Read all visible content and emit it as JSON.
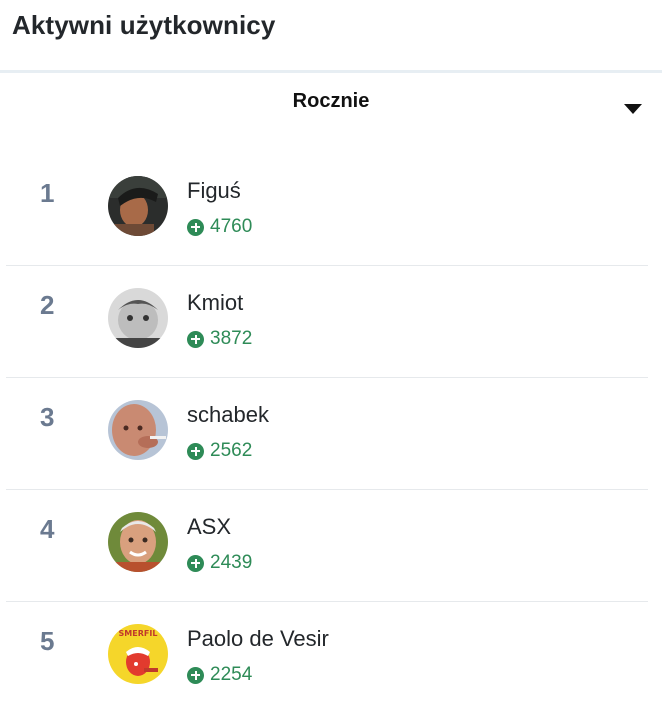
{
  "widget": {
    "title": "Aktywni użytkownicy",
    "period": {
      "selected": "Rocznie",
      "icon": "caret-down-icon"
    }
  },
  "users": [
    {
      "rank": "1",
      "name": "Figuś",
      "points": "4760"
    },
    {
      "rank": "2",
      "name": "Kmiot",
      "points": "3872"
    },
    {
      "rank": "3",
      "name": "schabek",
      "points": "2562"
    },
    {
      "rank": "4",
      "name": "ASX",
      "points": "2439"
    },
    {
      "rank": "5",
      "name": "Paolo de Vesir",
      "points": "2254"
    }
  ],
  "avatar_text": {
    "paolo_logo": "SMERFIL"
  },
  "colors": {
    "score_green": "#2e8b57",
    "rank_gray": "#6b7a90",
    "divider": "#e6e9ec"
  }
}
